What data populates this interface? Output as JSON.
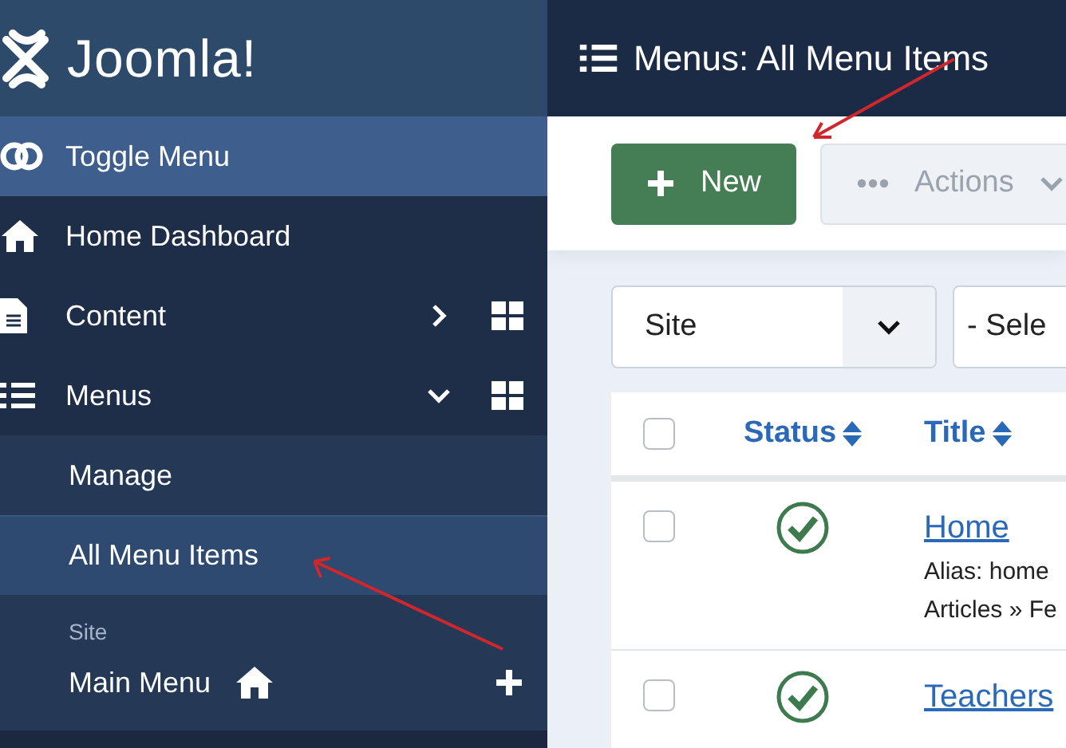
{
  "sidebar": {
    "logo": "Joomla!",
    "items": [
      {
        "label": "Toggle Menu",
        "kind": "toggle",
        "selected": true
      },
      {
        "label": "Home Dashboard",
        "kind": "link",
        "selected": false
      },
      {
        "label": "Content",
        "kind": "group",
        "expanded": false,
        "selected": false
      },
      {
        "label": "Menus",
        "kind": "group",
        "expanded": true,
        "selected": false,
        "children": [
          {
            "label": "Manage",
            "selected": false
          },
          {
            "label": "All Menu Items",
            "selected": true
          }
        ],
        "section": {
          "heading": "Site",
          "items": [
            {
              "label": "Main Menu",
              "home": true
            }
          ]
        }
      }
    ]
  },
  "header": {
    "title": "Menus: All Menu Items"
  },
  "toolbar": [
    {
      "label": "New",
      "kind": "primary"
    },
    {
      "label": "Actions",
      "kind": "dropdown",
      "disabled": true
    }
  ],
  "filters": [
    {
      "value": "Site"
    },
    {
      "value": "- Sele"
    }
  ],
  "table": {
    "all_checked": false,
    "columns": [
      {
        "label": "Status",
        "sortable": true
      },
      {
        "label": "Title",
        "sortable": true
      }
    ],
    "rows": [
      {
        "checked": false,
        "published": true,
        "title": "Home",
        "lines": [
          "Alias: home",
          "Articles » Fe"
        ]
      },
      {
        "checked": false,
        "published": true,
        "title": "Teachers",
        "lines": []
      }
    ]
  }
}
